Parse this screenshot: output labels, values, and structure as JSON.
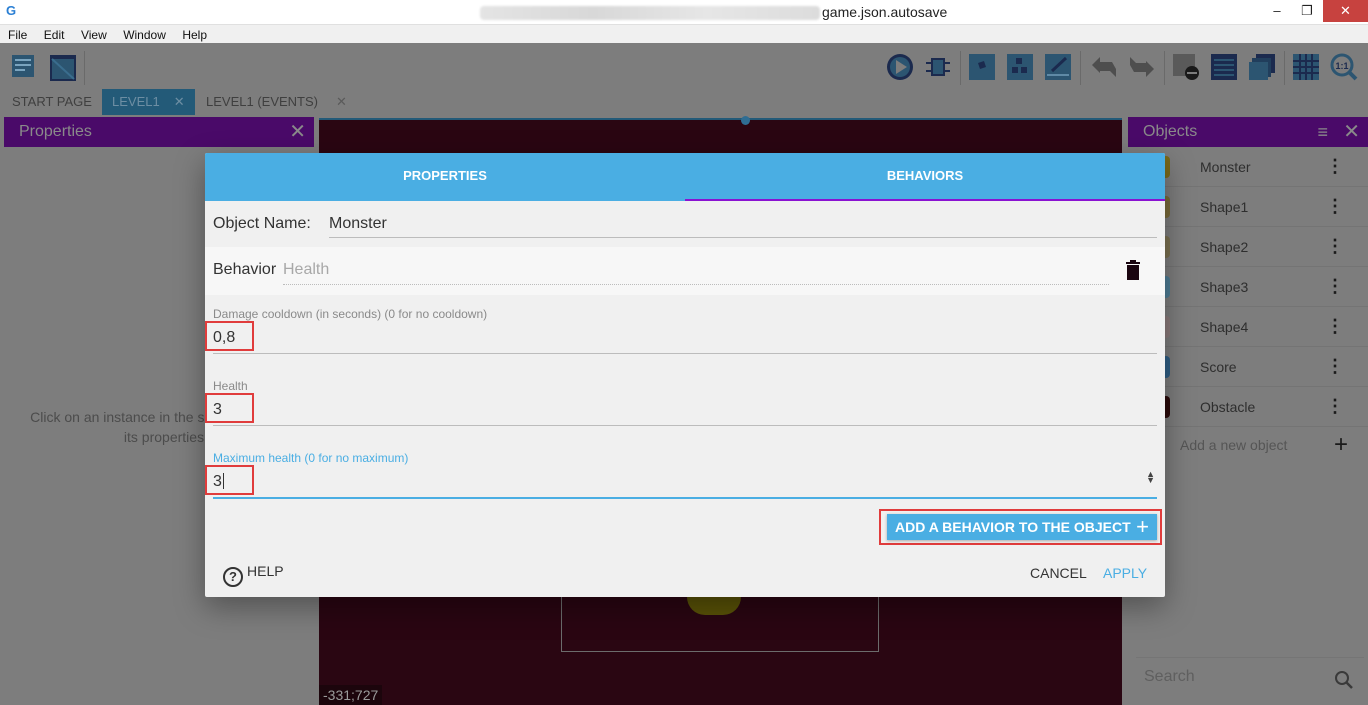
{
  "window": {
    "title": "game.json.autosave",
    "controls": {
      "minimize": "–",
      "maximize": "❐",
      "close": "✕"
    }
  },
  "menu": [
    "File",
    "Edit",
    "View",
    "Window",
    "Help"
  ],
  "toolbar": {
    "left_icons": [
      "project-manager-icon",
      "scene-window-icon"
    ],
    "right_icons": [
      "preview-play-icon",
      "debugger-icon",
      "add-instance-icon",
      "instances-list-icon",
      "edit-layers-icon",
      "undo-icon",
      "redo-icon",
      "delete-icon",
      "properties-list-icon",
      "layers-icon",
      "grid-icon",
      "zoom-reset-icon"
    ]
  },
  "tabs": [
    {
      "label": "START PAGE",
      "closable": false,
      "active": false
    },
    {
      "label": "LEVEL1",
      "closable": true,
      "active": true,
      "close": "✕"
    },
    {
      "label": "LEVEL1 (EVENTS)",
      "closable": true,
      "active": false,
      "close": "✕"
    }
  ],
  "properties_panel": {
    "title": "Properties",
    "close": "✕",
    "empty_line1": "Click on an instance in the scene to display",
    "empty_line2": "its properties"
  },
  "scene": {
    "coordinates": "-331;727"
  },
  "objects_panel": {
    "title": "Objects",
    "close": "✕",
    "filter": "≡",
    "items": [
      {
        "name": "Monster",
        "color": "#7a6a1a"
      },
      {
        "name": "Shape1",
        "color": "#7a6a3a"
      },
      {
        "name": "Shape2",
        "color": "#7a7050"
      },
      {
        "name": "Shape3",
        "color": "#4e7c94"
      },
      {
        "name": "Shape4",
        "color": "#8a7a7a"
      },
      {
        "name": "Score",
        "color": "#2f5e84"
      },
      {
        "name": "Obstacle",
        "color": "#2a0a0a"
      }
    ],
    "more": "⋮",
    "add_label": "Add a new object",
    "add_plus": "+",
    "search_placeholder": "Search"
  },
  "dialog": {
    "tabs": {
      "properties": "PROPERTIES",
      "behaviors": "BEHAVIORS"
    },
    "active_tab": "BEHAVIORS",
    "object_name_label": "Object Name:",
    "object_name": "Monster",
    "behavior_label": "Behavior",
    "behavior_name": "Health",
    "fields": [
      {
        "label": "Damage cooldown (in seconds) (0 for no cooldown)",
        "value": "0,8"
      },
      {
        "label": "Health",
        "value": "3"
      },
      {
        "label": "Maximum health (0 for no maximum)",
        "value": "3"
      }
    ],
    "add_behavior": "ADD A BEHAVIOR TO THE OBJECT",
    "add_plus": "+",
    "help": "HELP",
    "cancel": "CANCEL",
    "apply": "APPLY",
    "colors": {
      "accent": "#4aaee3",
      "tab_indicator": "#8a13d1",
      "highlight": "#e03c3c"
    }
  }
}
